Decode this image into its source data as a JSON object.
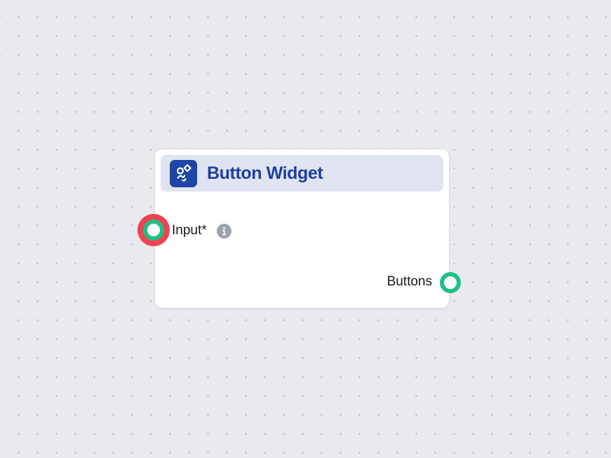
{
  "canvas": {
    "background_color": "#e9eaef",
    "dot_color": "#b9bdc8"
  },
  "node": {
    "title": "Button Widget",
    "icon": "widget-button-icon",
    "header_color": "#dfe4f0",
    "title_color": "#1f3f9e",
    "icon_background": "#1f45a8",
    "inputs": [
      {
        "label": "Input*",
        "info_icon": "info-icon",
        "port_color": "#1fbf85",
        "highlight_color": "#ef4352"
      }
    ],
    "outputs": [
      {
        "label": "Buttons",
        "port_color": "#1fbf85"
      }
    ]
  }
}
